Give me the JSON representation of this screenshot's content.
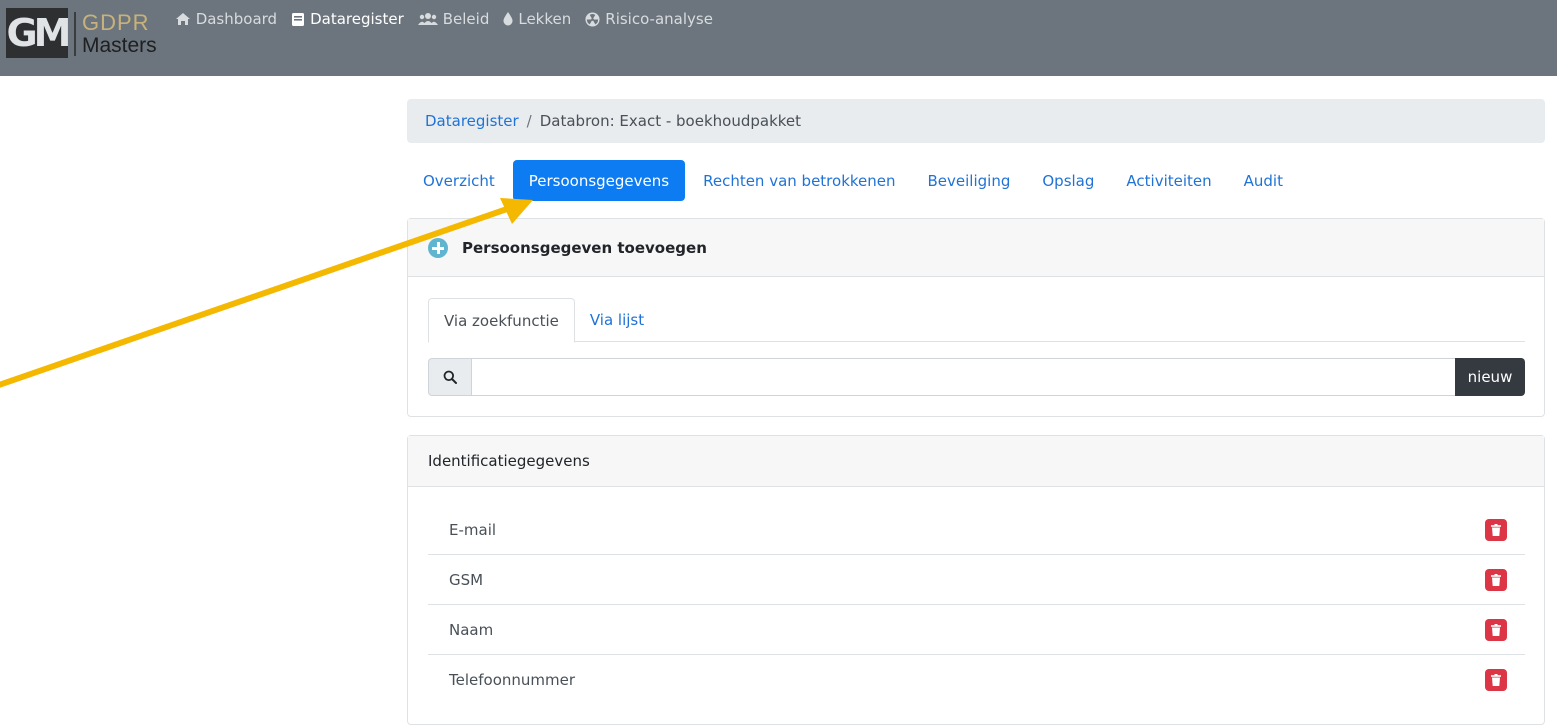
{
  "app": {
    "logo_mark": "GM",
    "logo_top": "GDPR",
    "logo_bottom": "Masters"
  },
  "nav": {
    "items": [
      {
        "label": "Dashboard",
        "icon": "home-icon"
      },
      {
        "label": "Dataregister",
        "icon": "book-icon"
      },
      {
        "label": "Beleid",
        "icon": "users-icon"
      },
      {
        "label": "Lekken",
        "icon": "droplet-icon"
      },
      {
        "label": "Risico-analyse",
        "icon": "radiation-icon"
      }
    ],
    "active": "Dataregister"
  },
  "breadcrumb": {
    "root": "Dataregister",
    "separator": "/",
    "current": "Databron: Exact - boekhoudpakket"
  },
  "tabs": [
    {
      "label": "Overzicht"
    },
    {
      "label": "Persoonsgegevens"
    },
    {
      "label": "Rechten van betrokkenen"
    },
    {
      "label": "Beveiliging"
    },
    {
      "label": "Opslag"
    },
    {
      "label": "Activiteiten"
    },
    {
      "label": "Audit"
    }
  ],
  "active_tab": "Persoonsgegevens",
  "add_card": {
    "title": "Persoonsgegeven toevoegen",
    "subtabs": [
      {
        "label": "Via zoekfunctie"
      },
      {
        "label": "Via lijst"
      }
    ],
    "active_subtab": "Via zoekfunctie",
    "search": {
      "value": "",
      "placeholder": ""
    },
    "new_label": "nieuw"
  },
  "list_card": {
    "title": "Identificatiegegevens",
    "items": [
      {
        "label": "E-mail"
      },
      {
        "label": "GSM"
      },
      {
        "label": "Naam"
      },
      {
        "label": "Telefoonnummer"
      }
    ]
  },
  "colors": {
    "navbar": "#6c757d",
    "primary": "#0d7cf2",
    "link": "#1f73d6",
    "danger": "#dc3545",
    "annotation_arrow": "#f5b800"
  }
}
